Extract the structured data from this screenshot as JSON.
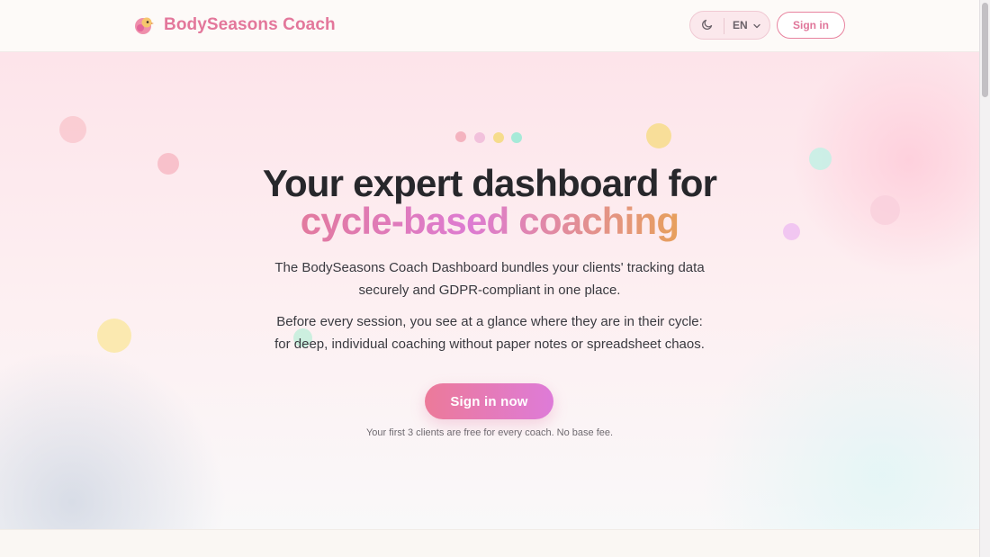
{
  "header": {
    "brand_name": "BodySeasons Coach",
    "language": "EN",
    "sign_in_label": "Sign in"
  },
  "hero": {
    "title_line1": "Your expert dashboard for",
    "title_line2": "cycle-based coaching",
    "paragraph1_line1": "The BodySeasons Coach Dashboard bundles your clients' tracking data",
    "paragraph1_line2": "securely and GDPR-compliant in one place.",
    "paragraph2_line1": "Before every session, you see at a glance where they are in their cycle:",
    "paragraph2_line2": "for deep, individual coaching without paper notes or spreadsheet chaos.",
    "cta_label": "Sign in now",
    "note": "Your first 3 clients are free for every coach. No base fee."
  },
  "icons": {
    "logo": "bird-logo-icon",
    "theme": "moon-icon",
    "language_chevron": "chevron-down-icon"
  },
  "colors": {
    "brand": "#e3779b",
    "accent_gradient_start": "#ec7a99",
    "accent_gradient_end": "#de7bd8",
    "title_gradient_end": "#e7a05c",
    "season_dots": [
      "#f4b3bf",
      "#f2c1dc",
      "#f6dc8c",
      "#a6ead8"
    ]
  }
}
